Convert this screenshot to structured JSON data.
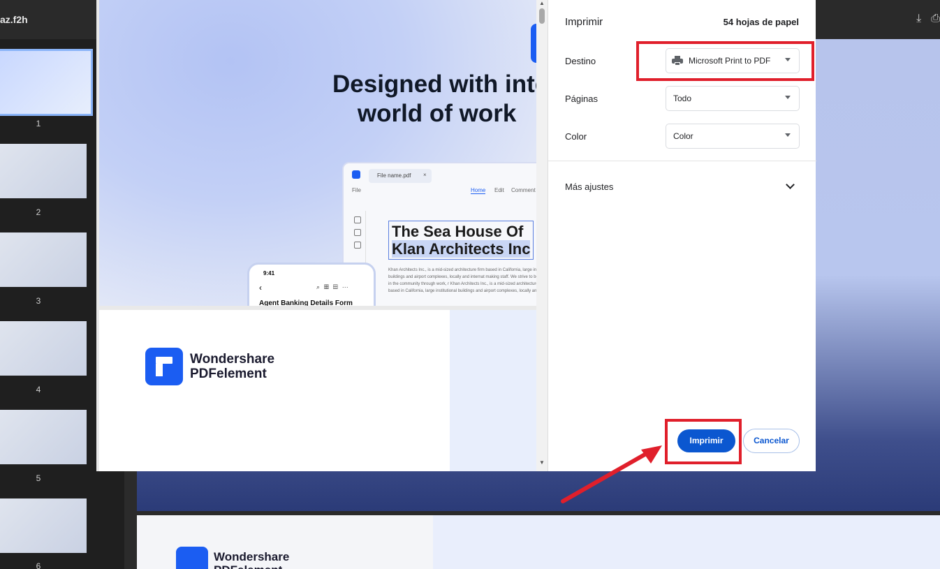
{
  "viewer": {
    "title": "az.f2h",
    "thumbnails": [
      "1",
      "2",
      "3",
      "4",
      "5",
      "6"
    ]
  },
  "preview": {
    "headline_line1": "Designed with inte",
    "headline_line2": "world of work",
    "app_tab": "File name.pdf",
    "app_menu_file": "File",
    "app_menu_home": "Home",
    "app_menu_edit": "Edit",
    "app_menu_comment": "Comment",
    "doc_title_line1": "The Sea House Of",
    "doc_title_line2": "Klan Architects Inc",
    "doc_body": "Khan Architects Inc., is a mid-sized architecture firm based in California, large institutional buildings and airport complexes, locally and internat making staff. We strive to be leaders in the community through work, r Khan Architects Inc., is a mid-sized architecture firm based in California, large institutional buildings and airport complexes, locally and internat",
    "phone_time": "9:41",
    "phone_form": "Agent Banking Details Form",
    "brand_line1": "Wondershare",
    "brand_line2": "PDFelement"
  },
  "print": {
    "title": "Imprimir",
    "sheets": "54 hojas de papel",
    "destination_label": "Destino",
    "destination_value": "Microsoft Print to PDF",
    "pages_label": "Páginas",
    "pages_value": "Todo",
    "color_label": "Color",
    "color_value": "Color",
    "more_settings": "Más ajustes",
    "print_button": "Imprimir",
    "cancel_button": "Cancelar"
  },
  "annotations": {
    "highlight_color": "#e01f2b"
  }
}
